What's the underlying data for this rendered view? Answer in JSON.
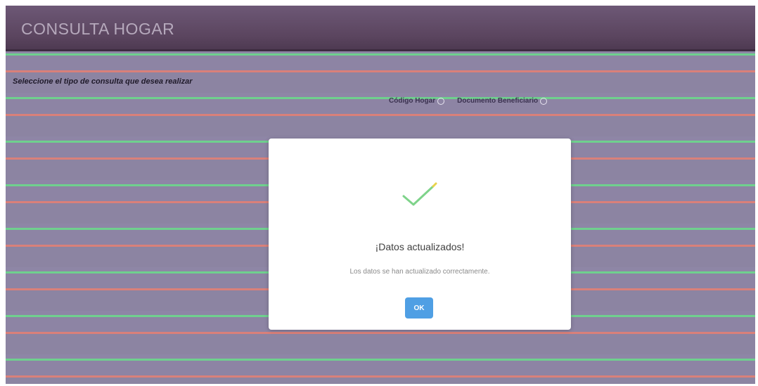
{
  "header": {
    "title": "CONSULTA HOGAR"
  },
  "form": {
    "prompt": "Seleccione el tipo de consulta que desea realizar",
    "options": [
      {
        "label": "Código Hogar"
      },
      {
        "label": "Documento Beneficiario"
      }
    ]
  },
  "dialog": {
    "icon": "check-icon",
    "title": "¡Datos actualizados!",
    "message": "Los datos se han actualizado correctamente.",
    "ok_label": "OK"
  },
  "colors": {
    "header": "#5b455f",
    "ok_button": "#4f9fe4",
    "check": "#7ed38a",
    "stripe_green": "#6fd08e",
    "stripe_red": "#d9807a"
  }
}
